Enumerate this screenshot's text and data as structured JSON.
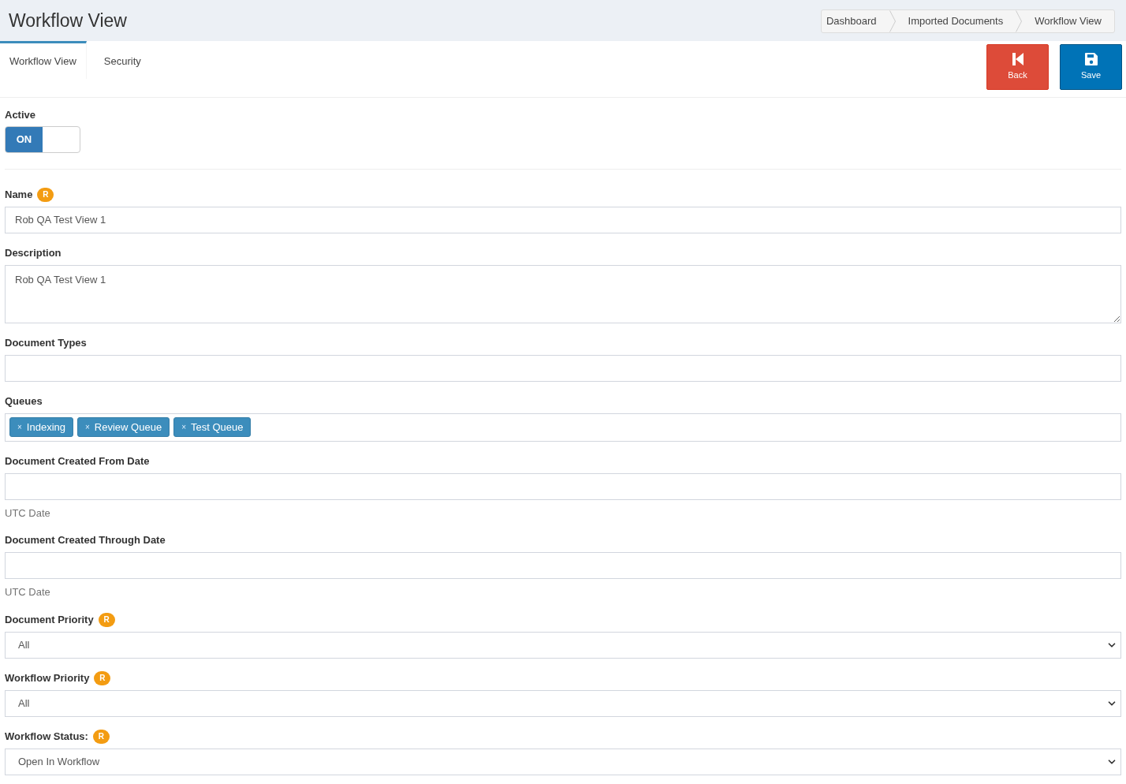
{
  "page_title": "Workflow View",
  "breadcrumb": [
    {
      "label": "Dashboard"
    },
    {
      "label": "Imported Documents"
    },
    {
      "label": "Workflow View"
    }
  ],
  "tabs": [
    {
      "label": "Workflow View",
      "selected": true
    },
    {
      "label": "Security",
      "selected": false
    }
  ],
  "actions": [
    {
      "kind": "back",
      "label": "Back"
    },
    {
      "kind": "save",
      "label": "Save"
    }
  ],
  "active": {
    "label": "Active",
    "on": true,
    "on_text": "ON"
  },
  "fields": [
    {
      "kind": "text",
      "label": "Name",
      "required": true,
      "required_mark": "R",
      "value": "Rob QA Test View 1"
    },
    {
      "kind": "textarea",
      "label": "Description",
      "required": false,
      "value": "Rob QA Test View 1"
    },
    {
      "kind": "text",
      "label": "Document Types",
      "required": false
    },
    {
      "kind": "tags",
      "label": "Queues",
      "required": false,
      "tags": [
        {
          "remove": "×",
          "label": "Indexing"
        },
        {
          "remove": "×",
          "label": "Review Queue"
        },
        {
          "remove": "×",
          "label": "Test Queue"
        }
      ]
    },
    {
      "kind": "text",
      "label": "Document Created From Date",
      "required": false,
      "help": "UTC Date"
    },
    {
      "kind": "text",
      "label": "Document Created Through Date",
      "required": false,
      "help": "UTC Date"
    },
    {
      "kind": "select",
      "label": "Document Priority",
      "required": true,
      "required_mark": "R",
      "value": "All"
    },
    {
      "kind": "select",
      "label": "Workflow Priority",
      "required": true,
      "required_mark": "R",
      "value": "All"
    },
    {
      "kind": "select",
      "label": "Workflow Status:",
      "required": true,
      "required_mark": "R",
      "value": "Open In Workflow"
    }
  ]
}
